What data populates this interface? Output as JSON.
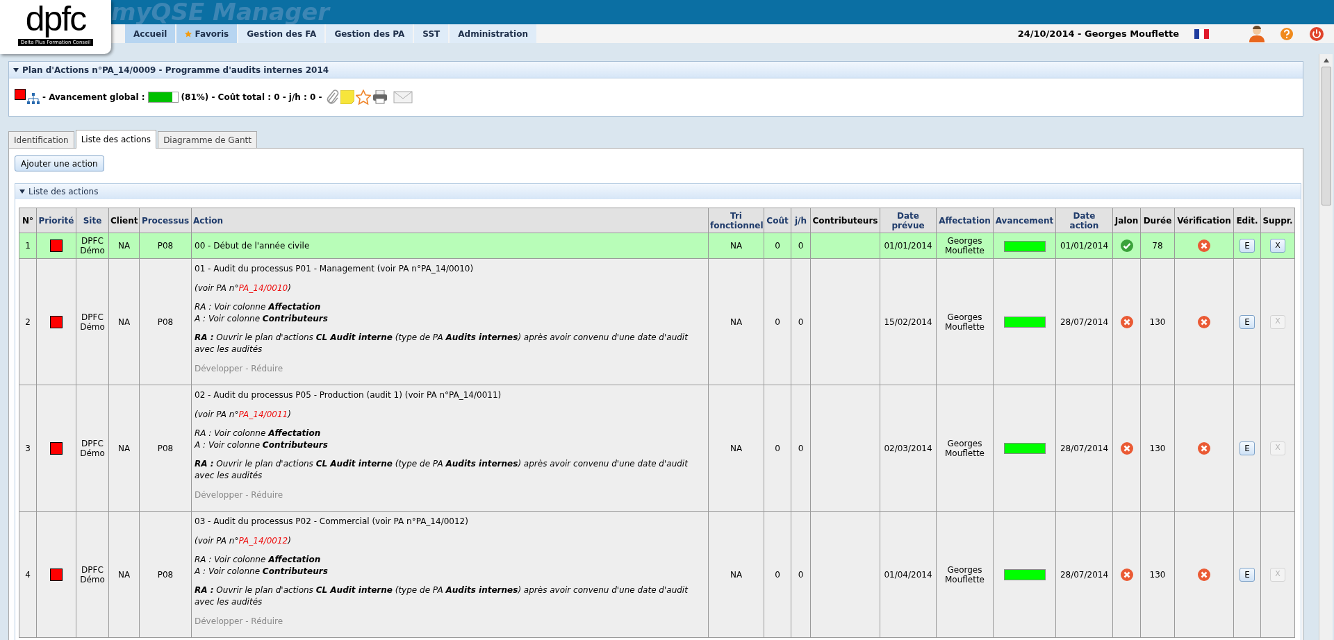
{
  "header": {
    "logo": {
      "text": "dpfc",
      "subtitle": "Delta Plus Formation Conseil"
    },
    "app_title": "myQSE Manager",
    "nav": [
      {
        "label": "Accueil",
        "selected": true,
        "star": false
      },
      {
        "label": "Favoris",
        "selected": true,
        "star": true
      },
      {
        "label": "Gestion des FA",
        "selected": false,
        "star": false
      },
      {
        "label": "Gestion des PA",
        "selected": false,
        "star": false
      },
      {
        "label": "SST",
        "selected": false,
        "star": false
      },
      {
        "label": "Administration",
        "selected": false,
        "star": false
      }
    ],
    "user": "24/10/2014 - Georges Mouflette"
  },
  "plan": {
    "title": "Plan d'Actions n°PA_14/0009 - Programme d'audits internes 2014",
    "expanded": true,
    "progress_label": "- Avancement global :",
    "level": 0.81,
    "summary": "(81%) - Coût total : 0 - j/h : 0 -"
  },
  "tabs": [
    {
      "label": "Identification",
      "selected": false
    },
    {
      "label": "Liste des actions",
      "selected": true
    },
    {
      "label": "Diagramme de Gantt",
      "selected": false
    }
  ],
  "add_button": "Ajouter une action",
  "section": {
    "title": "Liste des actions",
    "expanded": true
  },
  "table": {
    "columns": [
      {
        "label": "N°",
        "sortable": false
      },
      {
        "label": "Priorité",
        "sortable": true
      },
      {
        "label": "Site",
        "sortable": true
      },
      {
        "label": "Client",
        "sortable": false
      },
      {
        "label": "Processus",
        "sortable": true
      },
      {
        "label": "Action",
        "sortable": true
      },
      {
        "label": "Tri fonctionnel",
        "sortable": true
      },
      {
        "label": "Coût",
        "sortable": true
      },
      {
        "label": "j/h",
        "sortable": true
      },
      {
        "label": "Contributeurs",
        "sortable": false
      },
      {
        "label": "Date prévue",
        "sortable": true
      },
      {
        "label": "Affectation",
        "sortable": true
      },
      {
        "label": "Avancement",
        "sortable": true
      },
      {
        "label": "Date action",
        "sortable": true
      },
      {
        "label": "Jalon",
        "sortable": false
      },
      {
        "label": "Durée",
        "sortable": false
      },
      {
        "label": "Vérification",
        "sortable": false
      },
      {
        "label": "Edit.",
        "sortable": false
      },
      {
        "label": "Suppr.",
        "sortable": false
      }
    ],
    "rows": [
      {
        "number": "1",
        "highlighted": true,
        "site": "DPFC Démo",
        "client": "NA",
        "process": "P08",
        "action": {
          "title": "00 - Début de l'année civile"
        },
        "tri": "NA",
        "cost": "0",
        "jh": "0",
        "planned_date": "01/01/2014",
        "assignee": "Georges Mouflette",
        "level": 1,
        "action_date": "01/01/2014",
        "milestone_ok": true,
        "duration": "78",
        "verified": false,
        "edit": "E",
        "delete": {
          "label": "X",
          "disabled": false
        }
      },
      {
        "number": "2",
        "highlighted": false,
        "site": "DPFC Démo",
        "client": "NA",
        "process": "P08",
        "action": {
          "title": "01 - Audit du processus P01 - Management (voir PA n°PA_14/0010)",
          "ref": {
            "prefix": "(voir PA n°",
            "link": "PA_14/0010",
            "suffix": ")"
          },
          "roles": [
            "RA : Voir colonne **Affectation**",
            "A : Voir colonne **Contributeurs**"
          ],
          "instruction": "**RA :** Ouvrir le plan d'actions **CL Audit interne** (type de PA **Audits internes**) après avoir convenu d'une date d'audit avec les audités",
          "toggle": {
            "expand": "Développer",
            "separator": "-",
            "collapse": "Réduire"
          }
        },
        "tri": "NA",
        "cost": "0",
        "jh": "0",
        "planned_date": "15/02/2014",
        "assignee": "Georges Mouflette",
        "level": 1,
        "action_date": "28/07/2014",
        "milestone_ok": false,
        "duration": "130",
        "verified": false,
        "edit": "E",
        "delete": {
          "label": "X",
          "disabled": true
        }
      },
      {
        "number": "3",
        "highlighted": false,
        "site": "DPFC Démo",
        "client": "NA",
        "process": "P08",
        "action": {
          "title": "02 - Audit du processus P05 - Production (audit 1) (voir PA n°PA_14/0011)",
          "ref": {
            "prefix": "(voir PA n°",
            "link": "PA_14/0011",
            "suffix": ")"
          },
          "roles": [
            "RA : Voir colonne **Affectation**",
            "A : Voir colonne **Contributeurs**"
          ],
          "instruction": "**RA :** Ouvrir le plan d'actions **CL Audit interne** (type de PA **Audits internes**) après avoir convenu d'une date d'audit avec les audités",
          "toggle": {
            "expand": "Développer",
            "separator": "-",
            "collapse": "Réduire"
          }
        },
        "tri": "NA",
        "cost": "0",
        "jh": "0",
        "planned_date": "02/03/2014",
        "assignee": "Georges Mouflette",
        "level": 1,
        "action_date": "28/07/2014",
        "milestone_ok": false,
        "duration": "130",
        "verified": false,
        "edit": "E",
        "delete": {
          "label": "X",
          "disabled": true
        }
      },
      {
        "number": "4",
        "highlighted": false,
        "site": "DPFC Démo",
        "client": "NA",
        "process": "P08",
        "action": {
          "title": "03 - Audit du processus P02 - Commercial (voir PA n°PA_14/0012)",
          "ref": {
            "prefix": "(voir PA n°",
            "link": "PA_14/0012",
            "suffix": ")"
          },
          "roles": [
            "RA : Voir colonne **Affectation**",
            "A : Voir colonne **Contributeurs**"
          ],
          "instruction": "**RA :** Ouvrir le plan d'actions **CL Audit interne** (type de PA **Audits internes**) après avoir convenu d'une date d'audit avec les audités",
          "toggle": {
            "expand": "Développer",
            "separator": "-",
            "collapse": "Réduire"
          }
        },
        "tri": "NA",
        "cost": "0",
        "jh": "0",
        "planned_date": "01/04/2014",
        "assignee": "Georges Mouflette",
        "level": 1,
        "action_date": "28/07/2014",
        "milestone_ok": false,
        "duration": "130",
        "verified": false,
        "edit": "E",
        "delete": {
          "label": "X",
          "disabled": true
        }
      }
    ]
  }
}
